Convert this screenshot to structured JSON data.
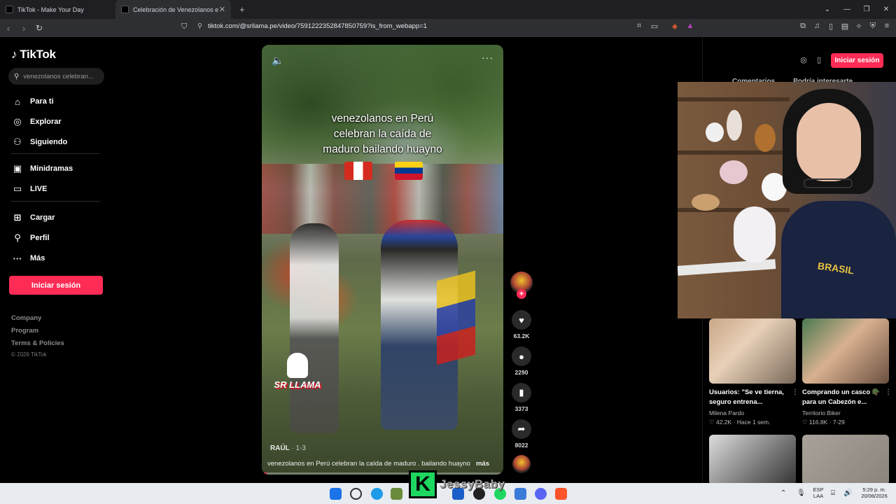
{
  "browser": {
    "tabs": [
      {
        "title": "TikTok - Make Your Day"
      },
      {
        "title": "Celebración de Venezolanos e"
      }
    ],
    "new_tab": "+",
    "url": "tiktok.com/@srllama.pe/video/7591222352847850759?is_from_webapp=1"
  },
  "sidebar": {
    "brand": "TikTok",
    "search_placeholder": "venezolanos celebran...",
    "nav": [
      {
        "label": "Para ti",
        "icon": "home-icon"
      },
      {
        "label": "Explorar",
        "icon": "compass-icon"
      },
      {
        "label": "Siguiendo",
        "icon": "following-icon"
      },
      {
        "label": "Minidramas",
        "icon": "minidramas-icon"
      },
      {
        "label": "LIVE",
        "icon": "live-icon"
      },
      {
        "label": "Cargar",
        "icon": "upload-icon"
      },
      {
        "label": "Perfil",
        "icon": "profile-icon"
      },
      {
        "label": "Más",
        "icon": "more-icon"
      }
    ],
    "login_button": "Iniciar sesión",
    "footer": [
      "Company",
      "Program",
      "Terms & Policies"
    ],
    "copyright": "© 2026 TikTok"
  },
  "video": {
    "caption_lines": [
      "venezolanos en Perú",
      "celebran la caída de",
      "maduro bailando huayno"
    ],
    "watermark": "SR LLAMA",
    "author": "RAÚL",
    "date": "· 1-3",
    "description": "venezolanos en Perú celebran la caída de maduro . bailando huayno",
    "more": "más",
    "progress": 0.02
  },
  "actions": {
    "likes": "63.2K",
    "comments": "2290",
    "saves": "3373",
    "shares": "8022"
  },
  "right_panel": {
    "login_button": "Iniciar sesión",
    "tabs": [
      "Comentarios",
      "Podría interesarte"
    ],
    "webcam_text": "BRASIL",
    "recommended": [
      {
        "title": "Usuarios: \"Se ve tierna, seguro entrena...",
        "author": "Milena Pardo",
        "stats": "♡ 42.2K · Hace 1 sem."
      },
      {
        "title": "Comprando un casco 🪖 para un Cabezón e...",
        "author": "Territorio Biker",
        "stats": "♡ 116.8K · 7-29"
      }
    ]
  },
  "stream_overlay": {
    "badge": "K",
    "name": "JessyBaby"
  },
  "taskbar": {
    "lang": "ESP",
    "lang2": "LAA",
    "time": "5:29 p. m.",
    "date": "20/08/2026"
  }
}
